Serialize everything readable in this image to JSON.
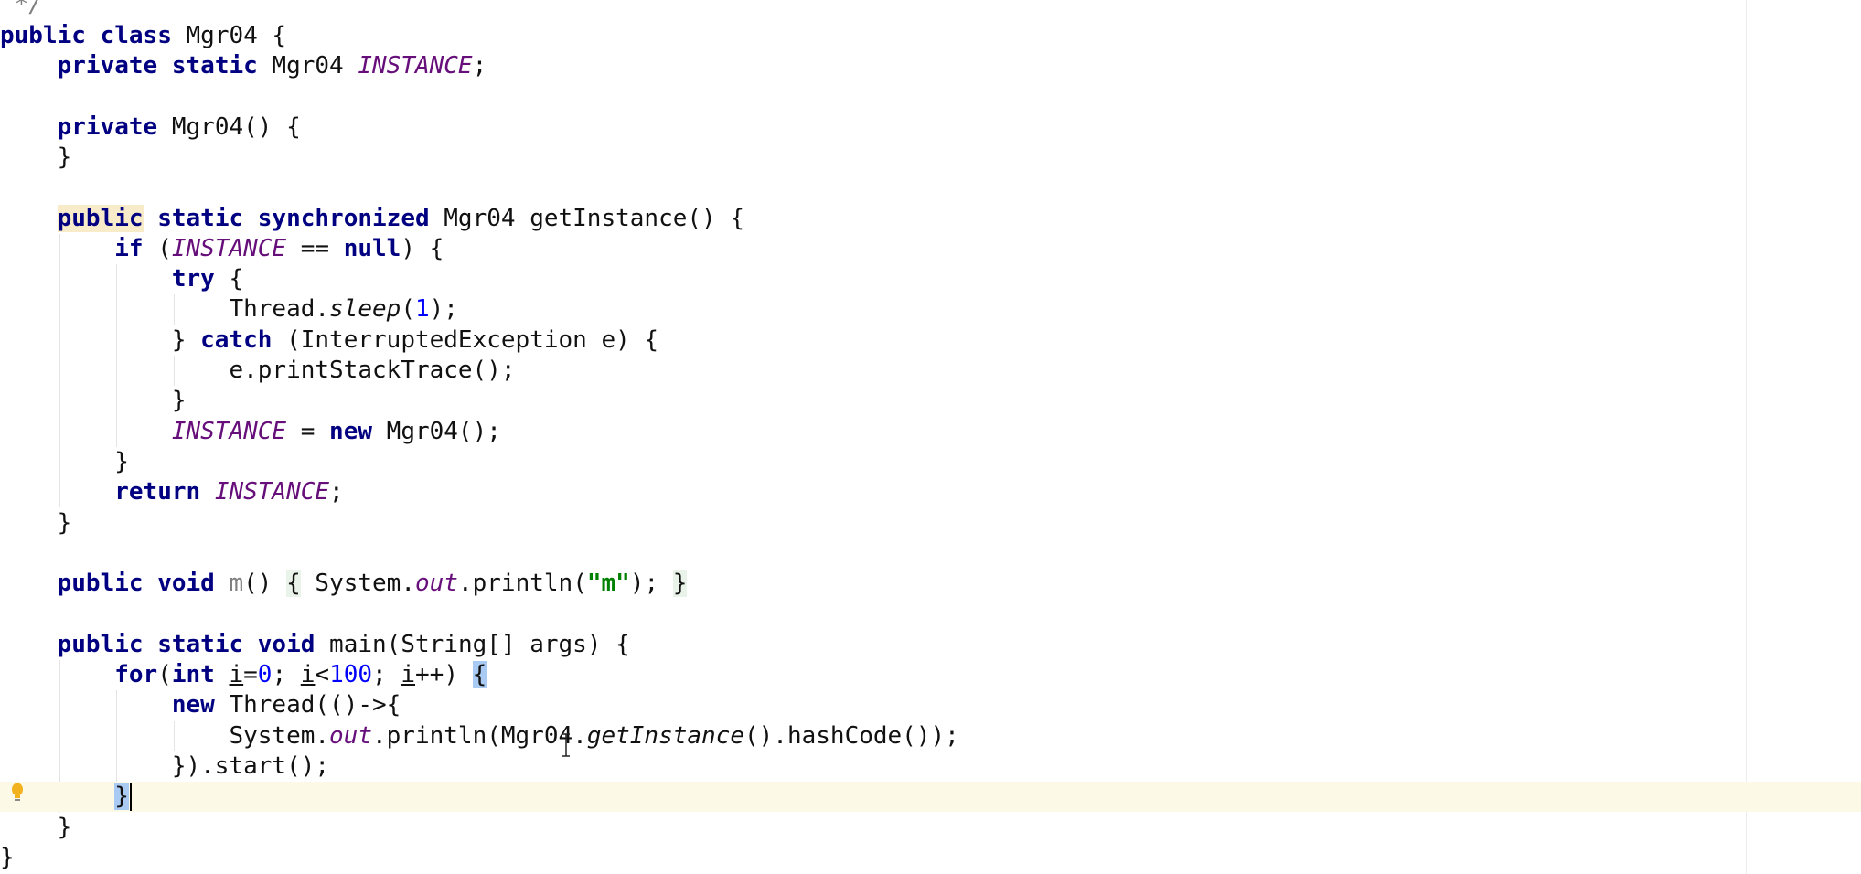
{
  "editor": {
    "current_line": 26,
    "colors": {
      "keyword": "#000080",
      "field": "#660e7a",
      "number": "#0000ff",
      "string": "#008000",
      "current_line_bg": "#fdf9e7"
    },
    "lines": [
      [
        [
          " */",
          "comment"
        ]
      ],
      [
        [
          "public",
          "kw"
        ],
        [
          " ",
          ""
        ],
        [
          "class",
          "kw"
        ],
        [
          " Mgr04 {",
          ""
        ]
      ],
      [
        [
          "    ",
          ""
        ],
        [
          "private",
          "kw"
        ],
        [
          " ",
          ""
        ],
        [
          "static",
          "kw"
        ],
        [
          " Mgr04 ",
          ""
        ],
        [
          "INSTANCE",
          "field"
        ],
        [
          ";",
          ""
        ]
      ],
      [],
      [
        [
          "    ",
          ""
        ],
        [
          "private",
          "kw"
        ],
        [
          " Mgr04() {",
          ""
        ]
      ],
      [
        [
          "    }",
          ""
        ]
      ],
      [],
      [
        [
          "    ",
          ""
        ],
        [
          "public",
          "kw hl"
        ],
        [
          " ",
          ""
        ],
        [
          "static",
          "kw"
        ],
        [
          " ",
          ""
        ],
        [
          "synchronized",
          "kw"
        ],
        [
          " Mgr04 getInstance() {",
          ""
        ]
      ],
      [
        [
          "        ",
          ""
        ],
        [
          "if",
          "kw"
        ],
        [
          " (",
          ""
        ],
        [
          "INSTANCE",
          "field"
        ],
        [
          " == ",
          ""
        ],
        [
          "null",
          "kw"
        ],
        [
          ") {",
          ""
        ]
      ],
      [
        [
          "            ",
          ""
        ],
        [
          "try",
          "kw"
        ],
        [
          " {",
          ""
        ]
      ],
      [
        [
          "                Thread.",
          ""
        ],
        [
          "sleep",
          "smeth"
        ],
        [
          "(",
          ""
        ],
        [
          "1",
          "num"
        ],
        [
          ");",
          ""
        ]
      ],
      [
        [
          "            } ",
          ""
        ],
        [
          "catch",
          "kw"
        ],
        [
          " (InterruptedException e) {",
          ""
        ]
      ],
      [
        [
          "                e.printStackTrace();",
          ""
        ]
      ],
      [
        [
          "            }",
          ""
        ]
      ],
      [
        [
          "            ",
          ""
        ],
        [
          "INSTANCE",
          "field"
        ],
        [
          " = ",
          ""
        ],
        [
          "new",
          "kw"
        ],
        [
          " Mgr04();",
          ""
        ]
      ],
      [
        [
          "        }",
          ""
        ]
      ],
      [
        [
          "        ",
          ""
        ],
        [
          "return",
          "kw"
        ],
        [
          " ",
          ""
        ],
        [
          "INSTANCE",
          "field"
        ],
        [
          ";",
          ""
        ]
      ],
      [
        [
          "    }",
          ""
        ]
      ],
      [],
      [
        [
          "    ",
          ""
        ],
        [
          "public",
          "kw"
        ],
        [
          " ",
          ""
        ],
        [
          "void",
          "kw"
        ],
        [
          " ",
          ""
        ],
        [
          "m",
          "unused"
        ],
        [
          "() ",
          ""
        ],
        [
          "{",
          "fold"
        ],
        [
          " System.",
          ""
        ],
        [
          "out",
          "field"
        ],
        [
          ".println(",
          ""
        ],
        [
          "\"m\"",
          "str"
        ],
        [
          "); ",
          ""
        ],
        [
          "}",
          "fold"
        ]
      ],
      [],
      [
        [
          "    ",
          ""
        ],
        [
          "public",
          "kw"
        ],
        [
          " ",
          ""
        ],
        [
          "static",
          "kw"
        ],
        [
          " ",
          ""
        ],
        [
          "void",
          "kw"
        ],
        [
          " main(String[] args) {",
          ""
        ]
      ],
      [
        [
          "        ",
          ""
        ],
        [
          "for",
          "kw"
        ],
        [
          "(",
          ""
        ],
        [
          "int",
          "kw"
        ],
        [
          " ",
          ""
        ],
        [
          "i",
          "under"
        ],
        [
          "=",
          ""
        ],
        [
          "0",
          "num"
        ],
        [
          "; ",
          ""
        ],
        [
          "i",
          "under"
        ],
        [
          "<",
          ""
        ],
        [
          "100",
          "num"
        ],
        [
          "; ",
          ""
        ],
        [
          "i",
          "under"
        ],
        [
          "++) ",
          ""
        ],
        [
          "{",
          "match"
        ]
      ],
      [
        [
          "            ",
          ""
        ],
        [
          "new",
          "kw"
        ],
        [
          " Thread(()->{",
          ""
        ]
      ],
      [
        [
          "                System.",
          ""
        ],
        [
          "out",
          "field"
        ],
        [
          ".println(Mgr04.",
          ""
        ],
        [
          "getInstance",
          "smeth"
        ],
        [
          "().hashCode());",
          ""
        ]
      ],
      [
        [
          "            }).start();",
          ""
        ]
      ],
      [
        [
          "        ",
          ""
        ],
        [
          "}",
          "match"
        ]
      ],
      [
        [
          "    }",
          ""
        ]
      ],
      [
        [
          "}",
          ""
        ]
      ]
    ]
  },
  "icons": {
    "gutter": "lightbulb-icon",
    "pointer": "text-cursor-icon"
  }
}
